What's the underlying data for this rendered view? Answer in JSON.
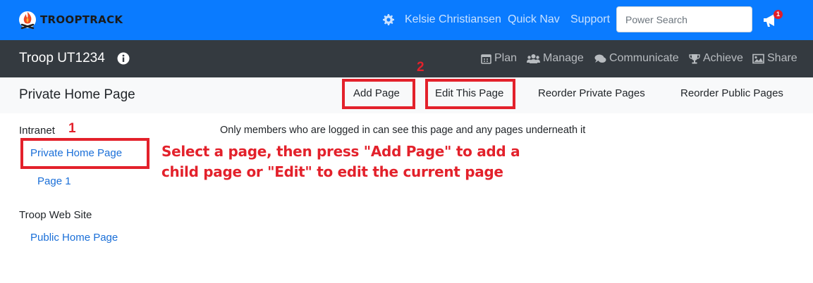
{
  "topbar": {
    "brand": "TROOPTRACK",
    "user_name": "Kelsie Christiansen",
    "quick_nav": "Quick Nav",
    "support": "Support",
    "search_placeholder": "Power Search",
    "notification_count": "1",
    "colors": {
      "background": "#0a7bff",
      "link": "#c9e1ff",
      "badge": "#e11d2a"
    },
    "icons": [
      "campfire-logo-icon",
      "gear-icon",
      "megaphone-icon"
    ]
  },
  "troopbar": {
    "troop_name": "Troop UT1234",
    "nav": [
      {
        "label": "Plan",
        "icon": "calendar-icon"
      },
      {
        "label": "Manage",
        "icon": "users-icon"
      },
      {
        "label": "Communicate",
        "icon": "comments-icon"
      },
      {
        "label": "Achieve",
        "icon": "trophy-icon"
      },
      {
        "label": "Share",
        "icon": "image-icon"
      }
    ]
  },
  "subbar": {
    "title": "Private Home Page",
    "add_page": "Add Page",
    "edit_page": "Edit This Page",
    "reorder_private": "Reorder Private Pages",
    "reorder_public": "Reorder Public Pages"
  },
  "sidebar": {
    "intranet_label": "Intranet",
    "intranet_pages": [
      "Private Home Page",
      "Page 1"
    ],
    "website_label": "Troop Web Site",
    "website_pages": [
      "Public Home Page"
    ]
  },
  "main": {
    "notice": "Only members who are logged in can see this page and any pages underneath it"
  },
  "annotations": {
    "step1": "1",
    "step2": "2",
    "instruction_line1": "Select a page, then press \"Add Page\" to add a",
    "instruction_line2": "child page or \"Edit\" to edit the current page",
    "color": "#e3212b"
  }
}
